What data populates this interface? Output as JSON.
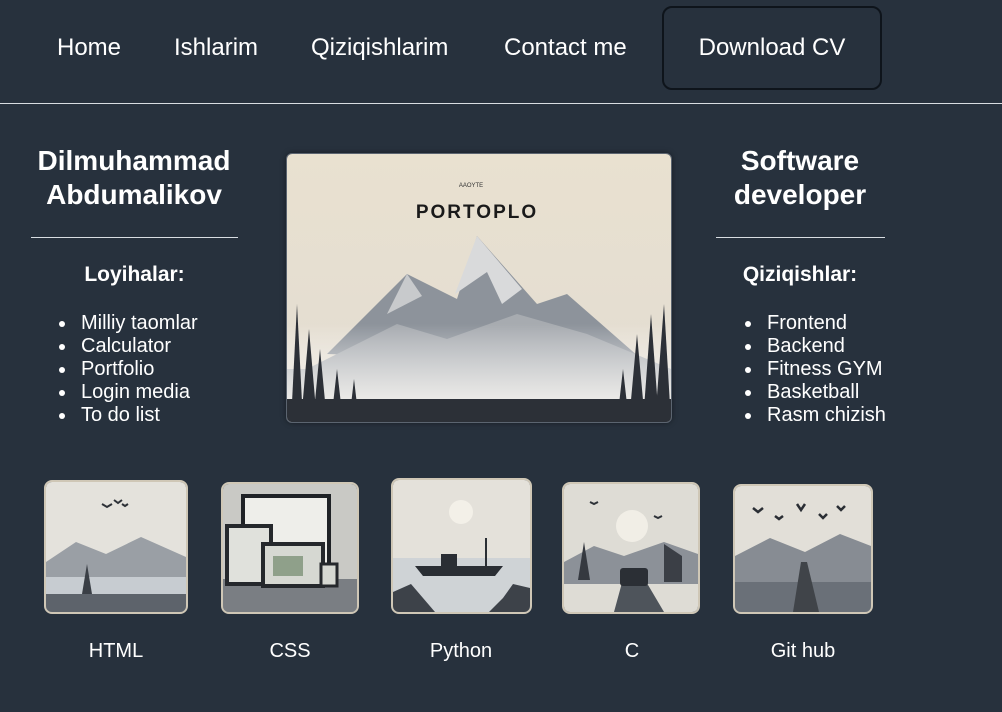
{
  "nav": {
    "links": [
      "Home",
      "Ishlarim",
      "Qiziqishlarim",
      "Contact me"
    ],
    "cv_button": "Download CV"
  },
  "left": {
    "name_line1": "Dilmuhammad",
    "name_line2": "Abdumalikov",
    "heading": "Loyihalar:",
    "items": [
      "Milliy taomlar",
      "Calculator",
      "Portfolio",
      "Login media",
      "To do list"
    ]
  },
  "hero": {
    "small_caption": "AAOYTE",
    "title": "PORTOPLO"
  },
  "right": {
    "title_line1": "Software",
    "title_line2": "developer",
    "heading": "Qiziqishlar:",
    "items": [
      "Frontend",
      "Backend",
      "Fitness GYM",
      "Basketball",
      "Rasm chizish"
    ]
  },
  "thumbs": {
    "labels": [
      "HTML",
      "CSS",
      "Python",
      "C",
      "Git hub"
    ]
  },
  "colors": {
    "background": "#27313d",
    "text": "#ffffff",
    "divider": "#d8dde2",
    "image_paper": "#e7dfcf"
  }
}
